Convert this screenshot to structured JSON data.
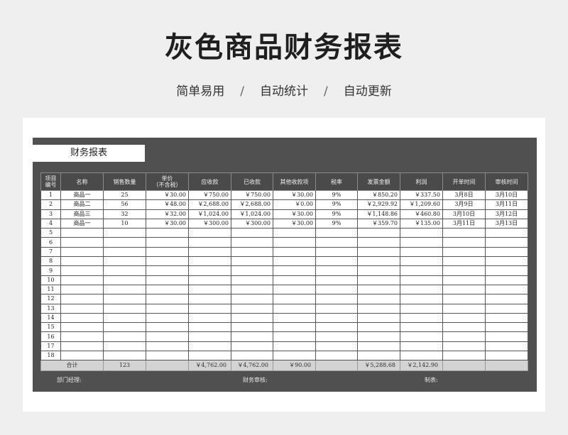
{
  "page": {
    "title": "灰色商品财务报表",
    "subtitle": [
      "简单易用",
      "自动统计",
      "自动更新"
    ],
    "separator": "/"
  },
  "report": {
    "title": "财务报表",
    "headers": [
      "项目\n编号",
      "名称",
      "销售数量",
      "单价\n（不含税）",
      "应收款",
      "已收款",
      "其他收款项",
      "税率",
      "发票金额",
      "利润",
      "开单时间",
      "审核时间"
    ],
    "rows": [
      [
        "1",
        "商品一",
        "25",
        "￥30.00",
        "￥750.00",
        "￥750.00",
        "￥30.00",
        "9%",
        "￥850.20",
        "￥337.50",
        "3月8日",
        "3月10日"
      ],
      [
        "2",
        "商品二",
        "56",
        "￥48.00",
        "￥2,688.00",
        "￥2,688.00",
        "￥0.00",
        "9%",
        "￥2,929.92",
        "￥1,209.60",
        "3月9日",
        "3月11日"
      ],
      [
        "3",
        "商品三",
        "32",
        "￥32.00",
        "￥1,024.00",
        "￥1,024.00",
        "￥30.00",
        "9%",
        "￥1,148.86",
        "￥460.80",
        "3月10日",
        "3月12日"
      ],
      [
        "4",
        "商品一",
        "10",
        "￥30.00",
        "￥300.00",
        "￥300.00",
        "￥30.00",
        "9%",
        "￥359.70",
        "￥135.00",
        "3月11日",
        "3月13日"
      ],
      [
        "5",
        "",
        "",
        "",
        "",
        "",
        "",
        "",
        "",
        "",
        "",
        ""
      ],
      [
        "6",
        "",
        "",
        "",
        "",
        "",
        "",
        "",
        "",
        "",
        "",
        ""
      ],
      [
        "7",
        "",
        "",
        "",
        "",
        "",
        "",
        "",
        "",
        "",
        "",
        ""
      ],
      [
        "8",
        "",
        "",
        "",
        "",
        "",
        "",
        "",
        "",
        "",
        "",
        ""
      ],
      [
        "9",
        "",
        "",
        "",
        "",
        "",
        "",
        "",
        "",
        "",
        "",
        ""
      ],
      [
        "10",
        "",
        "",
        "",
        "",
        "",
        "",
        "",
        "",
        "",
        "",
        ""
      ],
      [
        "11",
        "",
        "",
        "",
        "",
        "",
        "",
        "",
        "",
        "",
        "",
        ""
      ],
      [
        "12",
        "",
        "",
        "",
        "",
        "",
        "",
        "",
        "",
        "",
        "",
        ""
      ],
      [
        "13",
        "",
        "",
        "",
        "",
        "",
        "",
        "",
        "",
        "",
        "",
        ""
      ],
      [
        "14",
        "",
        "",
        "",
        "",
        "",
        "",
        "",
        "",
        "",
        "",
        ""
      ],
      [
        "15",
        "",
        "",
        "",
        "",
        "",
        "",
        "",
        "",
        "",
        "",
        ""
      ],
      [
        "16",
        "",
        "",
        "",
        "",
        "",
        "",
        "",
        "",
        "",
        "",
        ""
      ],
      [
        "17",
        "",
        "",
        "",
        "",
        "",
        "",
        "",
        "",
        "",
        "",
        ""
      ],
      [
        "18",
        "",
        "",
        "",
        "",
        "",
        "",
        "",
        "",
        "",
        "",
        ""
      ]
    ],
    "total": {
      "label": "合计",
      "quantity": "123",
      "receivable": "￥4,762.00",
      "received": "￥4,762.00",
      "other": "￥90.00",
      "invoice": "￥5,288.68",
      "profit": "￥2,142.90"
    },
    "footer": {
      "manager": "部门经理:",
      "auditor": "财务审核:",
      "maker": "制表:"
    }
  },
  "colors": {
    "panel": "#505050",
    "header": "#4a4a4a",
    "total_row": "#d3d3d3",
    "background": "#efefef"
  }
}
